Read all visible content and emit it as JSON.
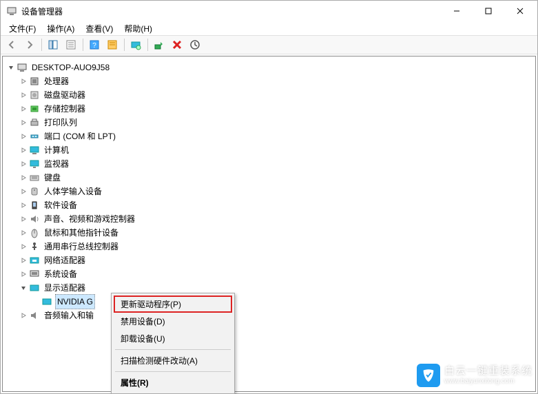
{
  "window": {
    "title": "设备管理器"
  },
  "menu": {
    "file": "文件(F)",
    "action": "操作(A)",
    "view": "查看(V)",
    "help": "帮助(H)"
  },
  "root": {
    "label": "DESKTOP-AUO9J58"
  },
  "categories": [
    {
      "label": "处理器",
      "icon": "cpu"
    },
    {
      "label": "磁盘驱动器",
      "icon": "disk"
    },
    {
      "label": "存储控制器",
      "icon": "storage"
    },
    {
      "label": "打印队列",
      "icon": "printer"
    },
    {
      "label": "端口 (COM 和 LPT)",
      "icon": "port"
    },
    {
      "label": "计算机",
      "icon": "computer"
    },
    {
      "label": "监视器",
      "icon": "monitor"
    },
    {
      "label": "键盘",
      "icon": "keyboard"
    },
    {
      "label": "人体学输入设备",
      "icon": "hid"
    },
    {
      "label": "软件设备",
      "icon": "software"
    },
    {
      "label": "声音、视频和游戏控制器",
      "icon": "sound"
    },
    {
      "label": "鼠标和其他指针设备",
      "icon": "mouse"
    },
    {
      "label": "通用串行总线控制器",
      "icon": "usb"
    },
    {
      "label": "网络适配器",
      "icon": "network"
    },
    {
      "label": "系统设备",
      "icon": "system"
    }
  ],
  "display_adapters": {
    "label": "显示适配器",
    "child": {
      "label": "NVIDIA G"
    }
  },
  "audio_io": {
    "label": "音频输入和输"
  },
  "context_menu": {
    "update": "更新驱动程序(P)",
    "disable": "禁用设备(D)",
    "uninstall": "卸载设备(U)",
    "scan": "扫描检测硬件改动(A)",
    "properties": "属性(R)"
  },
  "watermark": {
    "brand": "白云一键重装系统",
    "url": "www.baiyunxitong.com"
  }
}
